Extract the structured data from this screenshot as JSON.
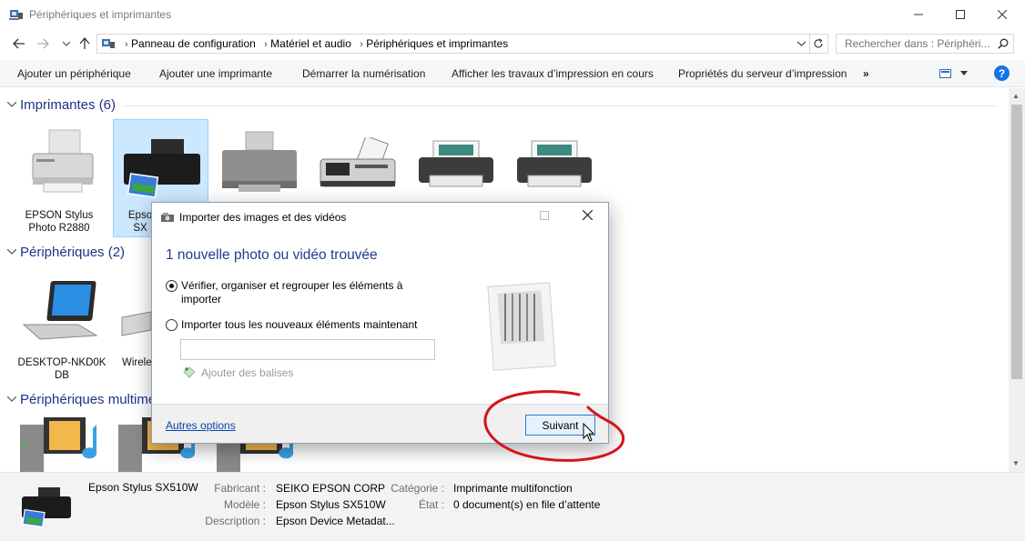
{
  "window": {
    "title": "Périphériques et imprimantes"
  },
  "address": {
    "crumbs": [
      "Panneau de configuration",
      "Matériel et audio",
      "Périphériques et imprimantes"
    ],
    "search_placeholder": "Rechercher dans : Périphéri..."
  },
  "toolbar": {
    "items": [
      "Ajouter un périphérique",
      "Ajouter une imprimante",
      "Démarrer la numérisation",
      "Afficher les travaux d’impression en cours",
      "Propriétés du serveur d’impression"
    ],
    "more": "»"
  },
  "groups": {
    "printers": {
      "title": "Imprimantes (6)",
      "devices": [
        {
          "l1": "EPSON Stylus",
          "l2": "Photo R2880"
        },
        {
          "l1": "Epso",
          "l2": "SX"
        }
      ]
    },
    "peripherals": {
      "title": "Périphériques (2)",
      "devices": [
        {
          "l1": "DESKTOP-NKD0K",
          "l2": "DB"
        },
        {
          "l1": "Wirele",
          "l2": ""
        }
      ]
    },
    "multimedia": {
      "title": "Périphériques multimé"
    }
  },
  "details": {
    "name": "Epson Stylus SX510W",
    "fabricant_label": "Fabricant :",
    "fabricant": "SEIKO EPSON CORP",
    "modele_label": "Modèle :",
    "modele": "Epson Stylus SX510W",
    "description_label": "Description :",
    "description": "Epson Device Metadat...",
    "categorie_label": "Catégorie :",
    "categorie": "Imprimante multifonction",
    "etat_label": "État :",
    "etat": "0 document(s) en file d’attente"
  },
  "dialog": {
    "title": "Importer des images et des vidéos",
    "heading": "1 nouvelle photo ou vidéo trouvée",
    "option1_line1": "Vérifier, organiser et regrouper les éléments à",
    "option1_line2": "importer",
    "option1_selected": true,
    "option2": "Importer tous les nouveaux éléments maintenant",
    "tag_button": "Ajouter des balises",
    "more_options": "Autres options",
    "next_button": "Suivant"
  },
  "colors": {
    "accent_blue": "#1e3d8a",
    "annotation_red": "#d4141c"
  }
}
